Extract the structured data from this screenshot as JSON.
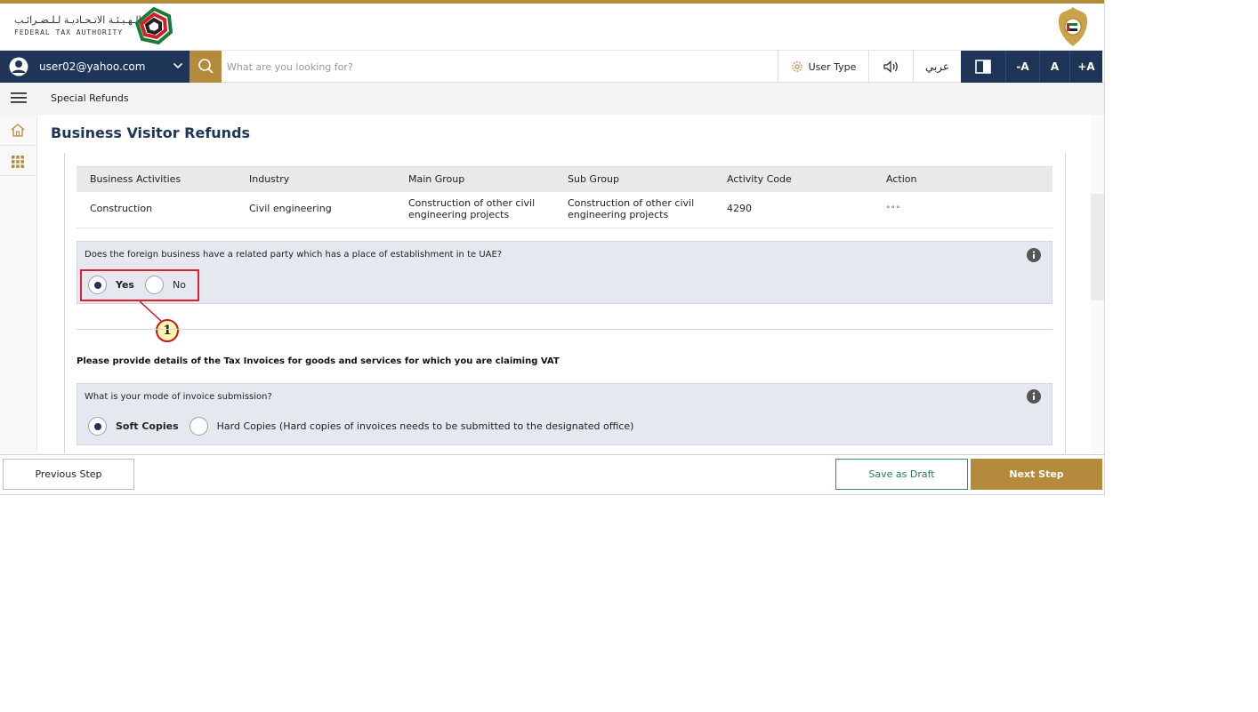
{
  "header": {
    "logo_arabic": "الـهـيـئـة الاتـحـاديـة لـلـضـرائـب",
    "logo_english": "FEDERAL TAX AUTHORITY"
  },
  "navbar": {
    "user_email": "user02@yahoo.com",
    "search_placeholder": "What are you looking for?",
    "user_type_label": "User Type",
    "language_label": "عربي",
    "font_decrease": "-A",
    "font_normal": "A",
    "font_increase": "+A"
  },
  "breadcrumb": {
    "current": "Special Refunds"
  },
  "page": {
    "title": "Business Visitor Refunds"
  },
  "activities_table": {
    "headers": [
      "Business Activities",
      "Industry",
      "Main Group",
      "Sub Group",
      "Activity Code",
      "Action"
    ],
    "rows": [
      {
        "business_activity": "Construction",
        "industry": "Civil engineering",
        "main_group": "Construction of other civil engineering projects",
        "sub_group": "Construction of other civil engineering projects",
        "activity_code": "4290",
        "action": "°°°"
      }
    ]
  },
  "related_party_question": {
    "text": "Does the foreign business have a related party which has a place of establishment in te UAE?",
    "options": [
      "Yes",
      "No"
    ],
    "selected": "Yes"
  },
  "callout": {
    "number": "1"
  },
  "invoices_section": {
    "title": "Please provide details of the Tax Invoices for goods and services for which you are claiming VAT",
    "question": "What is your mode of invoice submission?",
    "options": [
      "Soft Copies",
      "Hard Copies (Hard copies of invoices needs to be submitted to the designated office)"
    ],
    "selected": "Soft Copies"
  },
  "footer": {
    "previous_label": "Previous Step",
    "draft_label": "Save as Draft",
    "next_label": "Next Step"
  },
  "colors": {
    "brand_gold": "#b48a3c",
    "brand_navy": "#1e3557",
    "callout_red": "#e0202a"
  }
}
